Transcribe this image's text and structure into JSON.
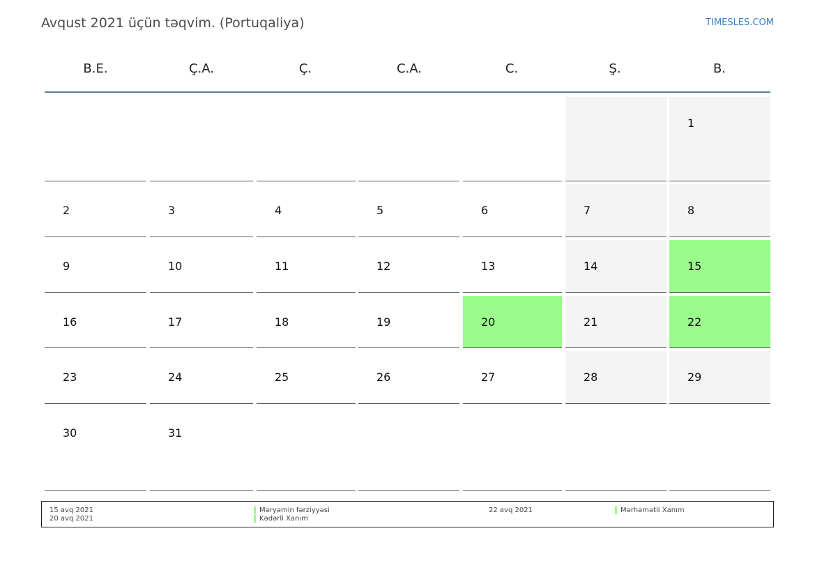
{
  "header": {
    "title": "Avqust 2021 üçün təqvim. (Portuqaliya)",
    "brand": "TIMESLES.COM"
  },
  "colors": {
    "holiday": "#9afc8a",
    "weekend": "#f4f4f4",
    "header_rule": "#5b7ea2",
    "brand": "#3a7fc1"
  },
  "weekdays": [
    "B.E.",
    "Ç.A.",
    "Ç.",
    "C.A.",
    "C.",
    "Ş.",
    "B."
  ],
  "weeks": [
    [
      null,
      null,
      null,
      null,
      null,
      null,
      1
    ],
    [
      2,
      3,
      4,
      5,
      6,
      7,
      8
    ],
    [
      9,
      10,
      11,
      12,
      13,
      14,
      15
    ],
    [
      16,
      17,
      18,
      19,
      20,
      21,
      22
    ],
    [
      23,
      24,
      25,
      26,
      27,
      28,
      29
    ],
    [
      30,
      31,
      null,
      null,
      null,
      null,
      null
    ]
  ],
  "holiday_days": [
    15,
    20,
    22
  ],
  "legend": {
    "left_dates": [
      "15 avq 2021",
      "20 avq 2021"
    ],
    "left_names": [
      "Məryəmin fərziyyəsi",
      "Kədərli Xanım"
    ],
    "right_dates": [
      "22 avq 2021"
    ],
    "right_names": [
      "Mərhəmətli Xanım"
    ]
  }
}
